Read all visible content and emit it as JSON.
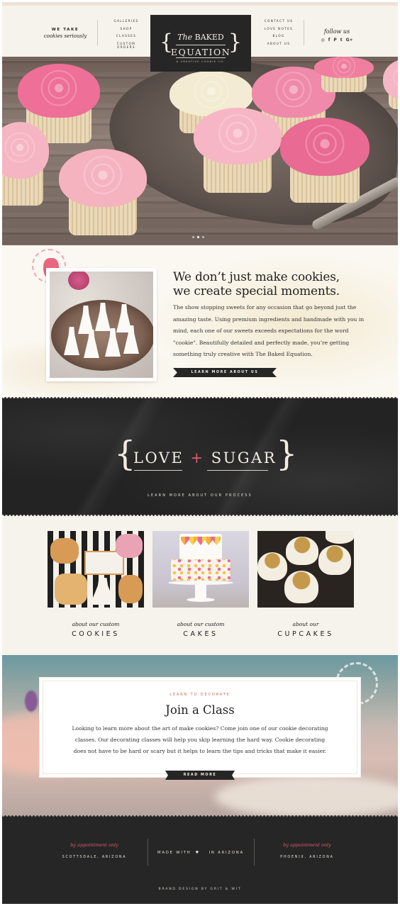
{
  "header": {
    "tagline_line1": "WE TAKE",
    "tagline_line2": "cookies seriously",
    "nav_left": [
      "GALLERIES",
      "SHOP",
      "CLASSES",
      "CUSTOM ORDERS"
    ],
    "nav_right": [
      "CONTACT US",
      "LOVE NOTES",
      "BLOG",
      "ABOUT US"
    ],
    "logo_line1_italic": "The",
    "logo_line1": "BAKED",
    "logo_line2": "EQUATION",
    "logo_sub": "A CREATIVE COOKIE CO.",
    "follow_label": "follow us",
    "social_icons": [
      {
        "name": "instagram-icon",
        "glyph": "◎"
      },
      {
        "name": "facebook-icon",
        "glyph": "f"
      },
      {
        "name": "pinterest-icon",
        "glyph": "P"
      },
      {
        "name": "twitter-icon",
        "glyph": "t"
      },
      {
        "name": "google-plus-icon",
        "glyph": "G+"
      }
    ]
  },
  "hero": {
    "slide_count": 3,
    "active_slide": 1
  },
  "about": {
    "heading_line1": "We don’t just make cookies,",
    "heading_line2": "we create special moments.",
    "body": "The show stopping sweets for any occasion that go beyond just the amazing taste. Using premium ingredients and handmade with you in mind, each one of our sweets exceeds expectations for the word \"cookie\". Beautifully detailed and perfectly made, you’re getting something truly creative with The Baked Equation.",
    "button_label": "LEARN MORE ABOUT US"
  },
  "love_sugar": {
    "word1": "LOVE",
    "plus": "+",
    "word2": "SUGAR",
    "link_label": "LEARN MORE ABOUT OUR PROCESS"
  },
  "products": [
    {
      "small": "about our custom",
      "big": "COOKIES"
    },
    {
      "small": "about our custom",
      "big": "CAKES"
    },
    {
      "small": "about our",
      "big": "CUPCAKES"
    }
  ],
  "class_card": {
    "kicker": "LEARN TO DECORATE",
    "title": "Join a Class",
    "body": "Looking to learn more about the art of make cookies? Come join one of our cookie decorating classes. Our decorating classes will help you skip learning the hard way. Cookie decorating does not have to be hard or scary but it helps to learn the tips and tricks that make it easier.",
    "button_label": "READ MORE"
  },
  "footer": {
    "left_script": "by appointment only",
    "left_city": "SCOTTSDALE, ARIZONA",
    "made_with": "MADE WITH",
    "in_arizona": "IN ARIZONA",
    "right_script": "by appointment only",
    "right_city": "PHOENIX, ARIZONA",
    "credit": "BRAND DESIGN BY GRIT & WIT"
  },
  "colors": {
    "cream": "#f6f3ec",
    "charcoal": "#262626",
    "accent_red": "#e15b6a",
    "pink_frosting": "#ee7ea2",
    "light_pink_frosting": "#f6b9c4"
  }
}
